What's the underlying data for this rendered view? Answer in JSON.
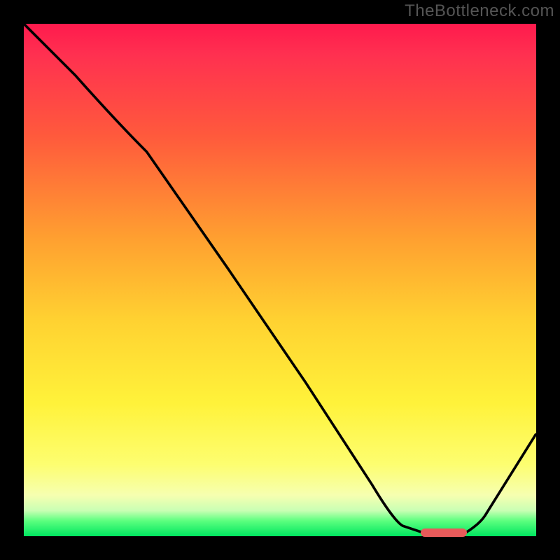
{
  "watermark": "TheBottleneck.com",
  "colors": {
    "background": "#000000",
    "gradient_top": "#ff1a4d",
    "gradient_mid_upper": "#ff8a33",
    "gradient_mid": "#ffd231",
    "gradient_mid_lower": "#fdfe70",
    "gradient_bottom": "#00e660",
    "curve": "#000000",
    "marker": "#e85a5a"
  },
  "chart_data": {
    "type": "line",
    "title": "",
    "xlabel": "",
    "ylabel": "",
    "xlim": [
      0,
      100
    ],
    "ylim": [
      0,
      100
    ],
    "series": [
      {
        "name": "curve",
        "x": [
          0,
          10,
          24,
          40,
          55,
          68,
          74,
          80,
          85,
          90,
          100
        ],
        "y": [
          100,
          90,
          75,
          52,
          30,
          10,
          2,
          0,
          0,
          4,
          20
        ]
      }
    ],
    "annotations": [
      {
        "name": "green-marker",
        "shape": "rounded-rect",
        "x_start": 78,
        "x_end": 86,
        "y": 0,
        "color": "#e85a5a"
      }
    ]
  }
}
